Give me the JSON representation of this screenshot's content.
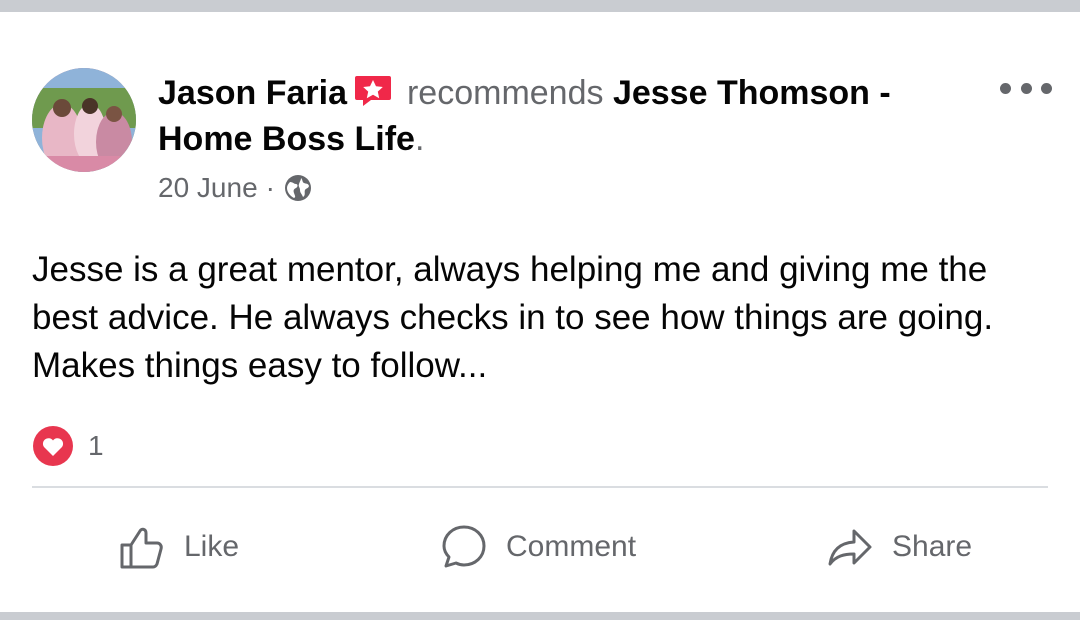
{
  "post": {
    "author": "Jason Faria",
    "verb": "recommends",
    "target": "Jesse Thomson - Home Boss Life",
    "date": "20 June",
    "separator": "·",
    "audience_icon": "globe-icon",
    "body": "Jesse is a great mentor, always helping me and giving me the best advice. He always checks in to see how things are going. Makes things easy to follow...",
    "reaction_icon": "heart-icon",
    "reaction_count": "1"
  },
  "actions": {
    "like_label": "Like",
    "comment_label": "Comment",
    "share_label": "Share"
  },
  "colors": {
    "text_primary": "#050505",
    "text_secondary": "#65676b",
    "badge": "#f02849",
    "heart": "#e8364f",
    "divider": "#dadde1"
  }
}
